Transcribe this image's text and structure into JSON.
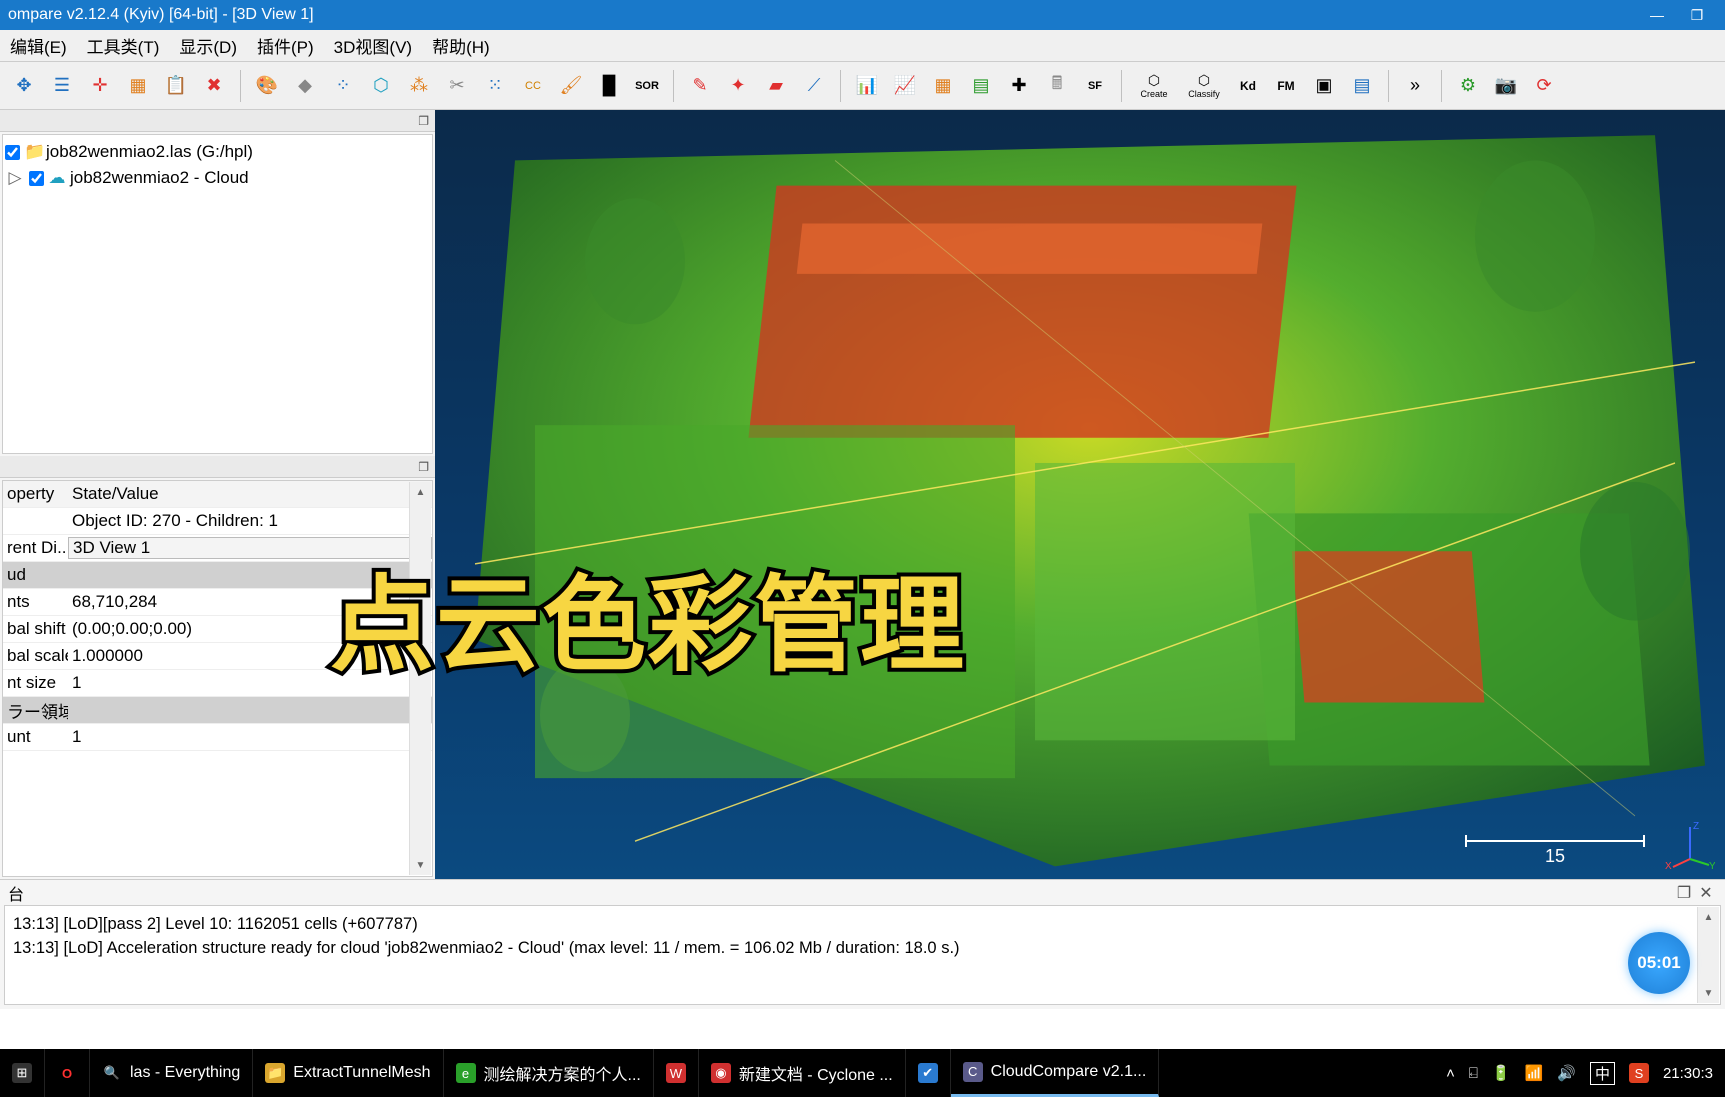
{
  "title": "ompare v2.12.4 (Kyiv) [64-bit] - [3D View 1]",
  "menu": {
    "edit": "编辑(E)",
    "tools": "工具类(T)",
    "display": "显示(D)",
    "plugins": "插件(P)",
    "view3d": "3D视图(V)",
    "help": "帮助(H)"
  },
  "dbtree": {
    "root": {
      "label": "job82wenmiao2.las (G:/hpl)"
    },
    "child": {
      "label": "job82wenmiao2 - Cloud"
    }
  },
  "props": {
    "hdr_prop": "operty",
    "hdr_val": "State/Value",
    "rows": [
      {
        "k": "",
        "v": "Object ID: 270 - Children: 1"
      },
      {
        "k": "rent Di...",
        "v": "3D View 1",
        "combo": true
      },
      {
        "k": "ud",
        "v": "",
        "cat": true
      },
      {
        "k": "nts",
        "v": "68,710,284"
      },
      {
        "k": "bal shift",
        "v": "(0.00;0.00;0.00)"
      },
      {
        "k": "bal scale",
        "v": "1.000000"
      },
      {
        "k": "nt size",
        "v": "1"
      },
      {
        "k": "ラー領域",
        "v": "",
        "cat": true
      },
      {
        "k": "unt",
        "v": "1"
      }
    ]
  },
  "viewport": {
    "scale": "15",
    "axes": {
      "x": "X",
      "y": "Y",
      "z": "Z"
    }
  },
  "overlay": "点云色彩管理",
  "timer": "05:01",
  "console": {
    "label": "台",
    "lines": [
      "13:13] [LoD][pass 2] Level 10: 1162051 cells (+607787)",
      "13:13] [LoD] Acceleration structure ready for cloud 'job82wenmiao2 - Cloud' (max level: 11 / mem. = 106.02 Mb / duration: 18.0 s.)"
    ]
  },
  "taskbar": {
    "search": "las - Everything",
    "items": [
      {
        "label": "ExtractTunnelMesh",
        "icon": "📁",
        "bg": "#d9a62e"
      },
      {
        "label": "测绘解决方案的个人...",
        "icon": "e",
        "bg": "#2aa02a"
      },
      {
        "label": "",
        "icon": "W",
        "bg": "#d03030"
      },
      {
        "label": "新建文档 - Cyclone ...",
        "icon": "◉",
        "bg": "#d03030"
      },
      {
        "label": "",
        "icon": "✔",
        "bg": "#2a7ad0"
      },
      {
        "label": "CloudCompare v2.1...",
        "icon": "C",
        "bg": "#5a5a8a",
        "active": true
      }
    ],
    "tray": {
      "ime": "中",
      "clock": "21:30:3"
    }
  },
  "toolbar_labels": {
    "canupo_create": "Create",
    "canupo_classify": "Classify",
    "kd": "Kd",
    "fm": "FM",
    "sor": "SOR",
    "sf": "SF",
    "cc": "CC"
  }
}
